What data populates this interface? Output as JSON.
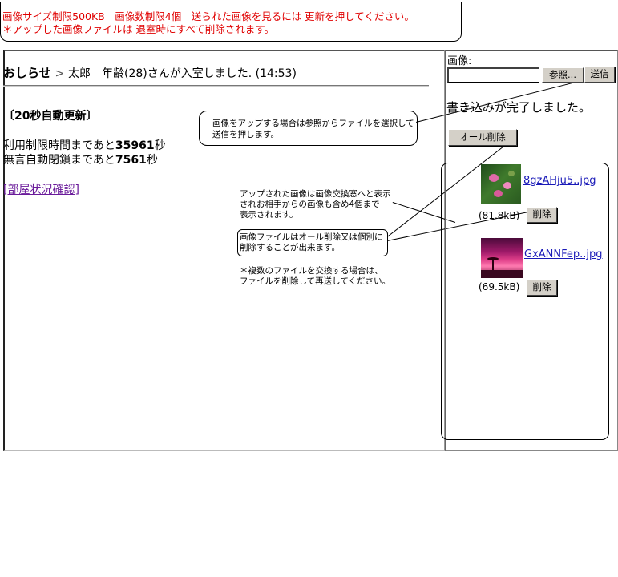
{
  "notice": {
    "line1": "画像サイズ制限500KB　画像数制限4個　送られた画像を見るには 更新を押してください。",
    "line2": "＊アップした画像ファイルは 退室時にすべて削除されます。"
  },
  "main": {
    "announce_label": "おしらせ",
    "announce_arrow": ">",
    "announce_text": "太郎　年齢(28)さんが入室しました. (14:53)",
    "auto_refresh": "〔20秒自動更新〕",
    "limit_prefix": "利用制限時間まであと",
    "limit_value": "35961",
    "limit_unit": "秒",
    "idle_prefix": "無言自動閉鎖まであと",
    "idle_value": "7561",
    "idle_unit": "秒",
    "room_status_link": "[部屋状況確認]"
  },
  "callouts": {
    "upload_hint_line1": "画像をアップする場合は参照からファイルを選択して",
    "upload_hint_line2": "送信を押します。",
    "exchange_line1": "アップされた画像は画像交換窓へと表示",
    "exchange_line2": "されお相手からの画像も含め4個まで",
    "exchange_line3": "表示されます。",
    "delete_line1": "画像ファイルはオール削除又は個別に",
    "delete_line2": "削除することが出来ます。",
    "multi_line1": "＊複数のファイルを交換する場合は、",
    "multi_line2": "ファイルを削除して再送してください。"
  },
  "side": {
    "image_label": "画像:",
    "file_input_value": "",
    "browse_label": "参照...",
    "send_label": "送信",
    "complete_message": "書き込みが完了しました。",
    "delete_all_label": "オール削除",
    "files": [
      {
        "name": "8gzAHju5..jpg",
        "size": "(81.8kB)",
        "delete_label": "削除"
      },
      {
        "name": "GxANNFep..jpg",
        "size": "(69.5kB)",
        "delete_label": "削除"
      }
    ]
  }
}
